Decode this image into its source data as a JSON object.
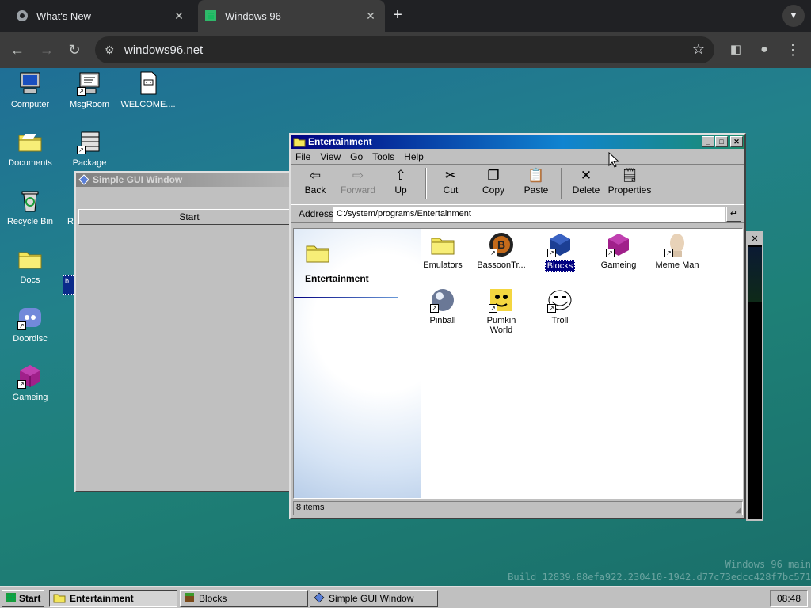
{
  "browser": {
    "tabs": [
      {
        "title": "What's New",
        "icon": "chrome-icon"
      },
      {
        "title": "Windows 96",
        "icon": "windows96-icon"
      }
    ],
    "url": "windows96.net"
  },
  "desktop_icons": [
    {
      "label": "Computer",
      "icon": "computer-icon"
    },
    {
      "label": "MsgRoom",
      "icon": "msgroom-icon"
    },
    {
      "label": "WELCOME....",
      "icon": "document-icon"
    },
    {
      "label": "Documents",
      "icon": "folder-icon"
    },
    {
      "label": "Package",
      "icon": "package-icon"
    },
    {
      "label": "Recycle Bin",
      "icon": "recycle-bin-icon"
    },
    {
      "label": "Docs",
      "icon": "folder-icon"
    },
    {
      "label": "Doordisc",
      "icon": "discord-icon"
    },
    {
      "label": "Gameing",
      "icon": "cube-icon"
    }
  ],
  "partial_labels": {
    "r": "R",
    "b": "b"
  },
  "simple_window": {
    "title": "Simple GUI Window",
    "button": "Start"
  },
  "explorer": {
    "title": "Entertainment",
    "menu": [
      "File",
      "View",
      "Go",
      "Tools",
      "Help"
    ],
    "toolbar": [
      "Back",
      "Forward",
      "Up",
      "Cut",
      "Copy",
      "Paste",
      "Delete",
      "Properties"
    ],
    "address_label": "Address",
    "address": "C:/system/programs/Entertainment",
    "panel_title": "Entertainment",
    "items": [
      {
        "label": "Emulators",
        "icon": "folder-icon"
      },
      {
        "label": "BassoonTr...",
        "icon": "bassoon-icon"
      },
      {
        "label": "Blocks",
        "icon": "blocks-icon",
        "selected": true
      },
      {
        "label": "Gameing",
        "icon": "cube-icon"
      },
      {
        "label": "Meme Man",
        "icon": "meme-man-icon"
      },
      {
        "label": "Pinball",
        "icon": "pinball-icon"
      },
      {
        "label": "Pumkin World",
        "icon": "pumkin-icon"
      },
      {
        "label": "Troll",
        "icon": "troll-face-icon"
      }
    ],
    "status": "8 items"
  },
  "taskbar": {
    "start": "Start",
    "items": [
      "Entertainment",
      "Blocks",
      "Simple GUI Window"
    ],
    "clock": "08:48"
  },
  "watermark": {
    "line1": "Windows 96 main",
    "line2": "Build 12839.88efa922.230410-1942.d77c73edcc428f7bc571"
  },
  "colors": {
    "titlebar_active": "#000080",
    "titlebar_inactive": "#808080",
    "desktop": "#1f7f85"
  }
}
